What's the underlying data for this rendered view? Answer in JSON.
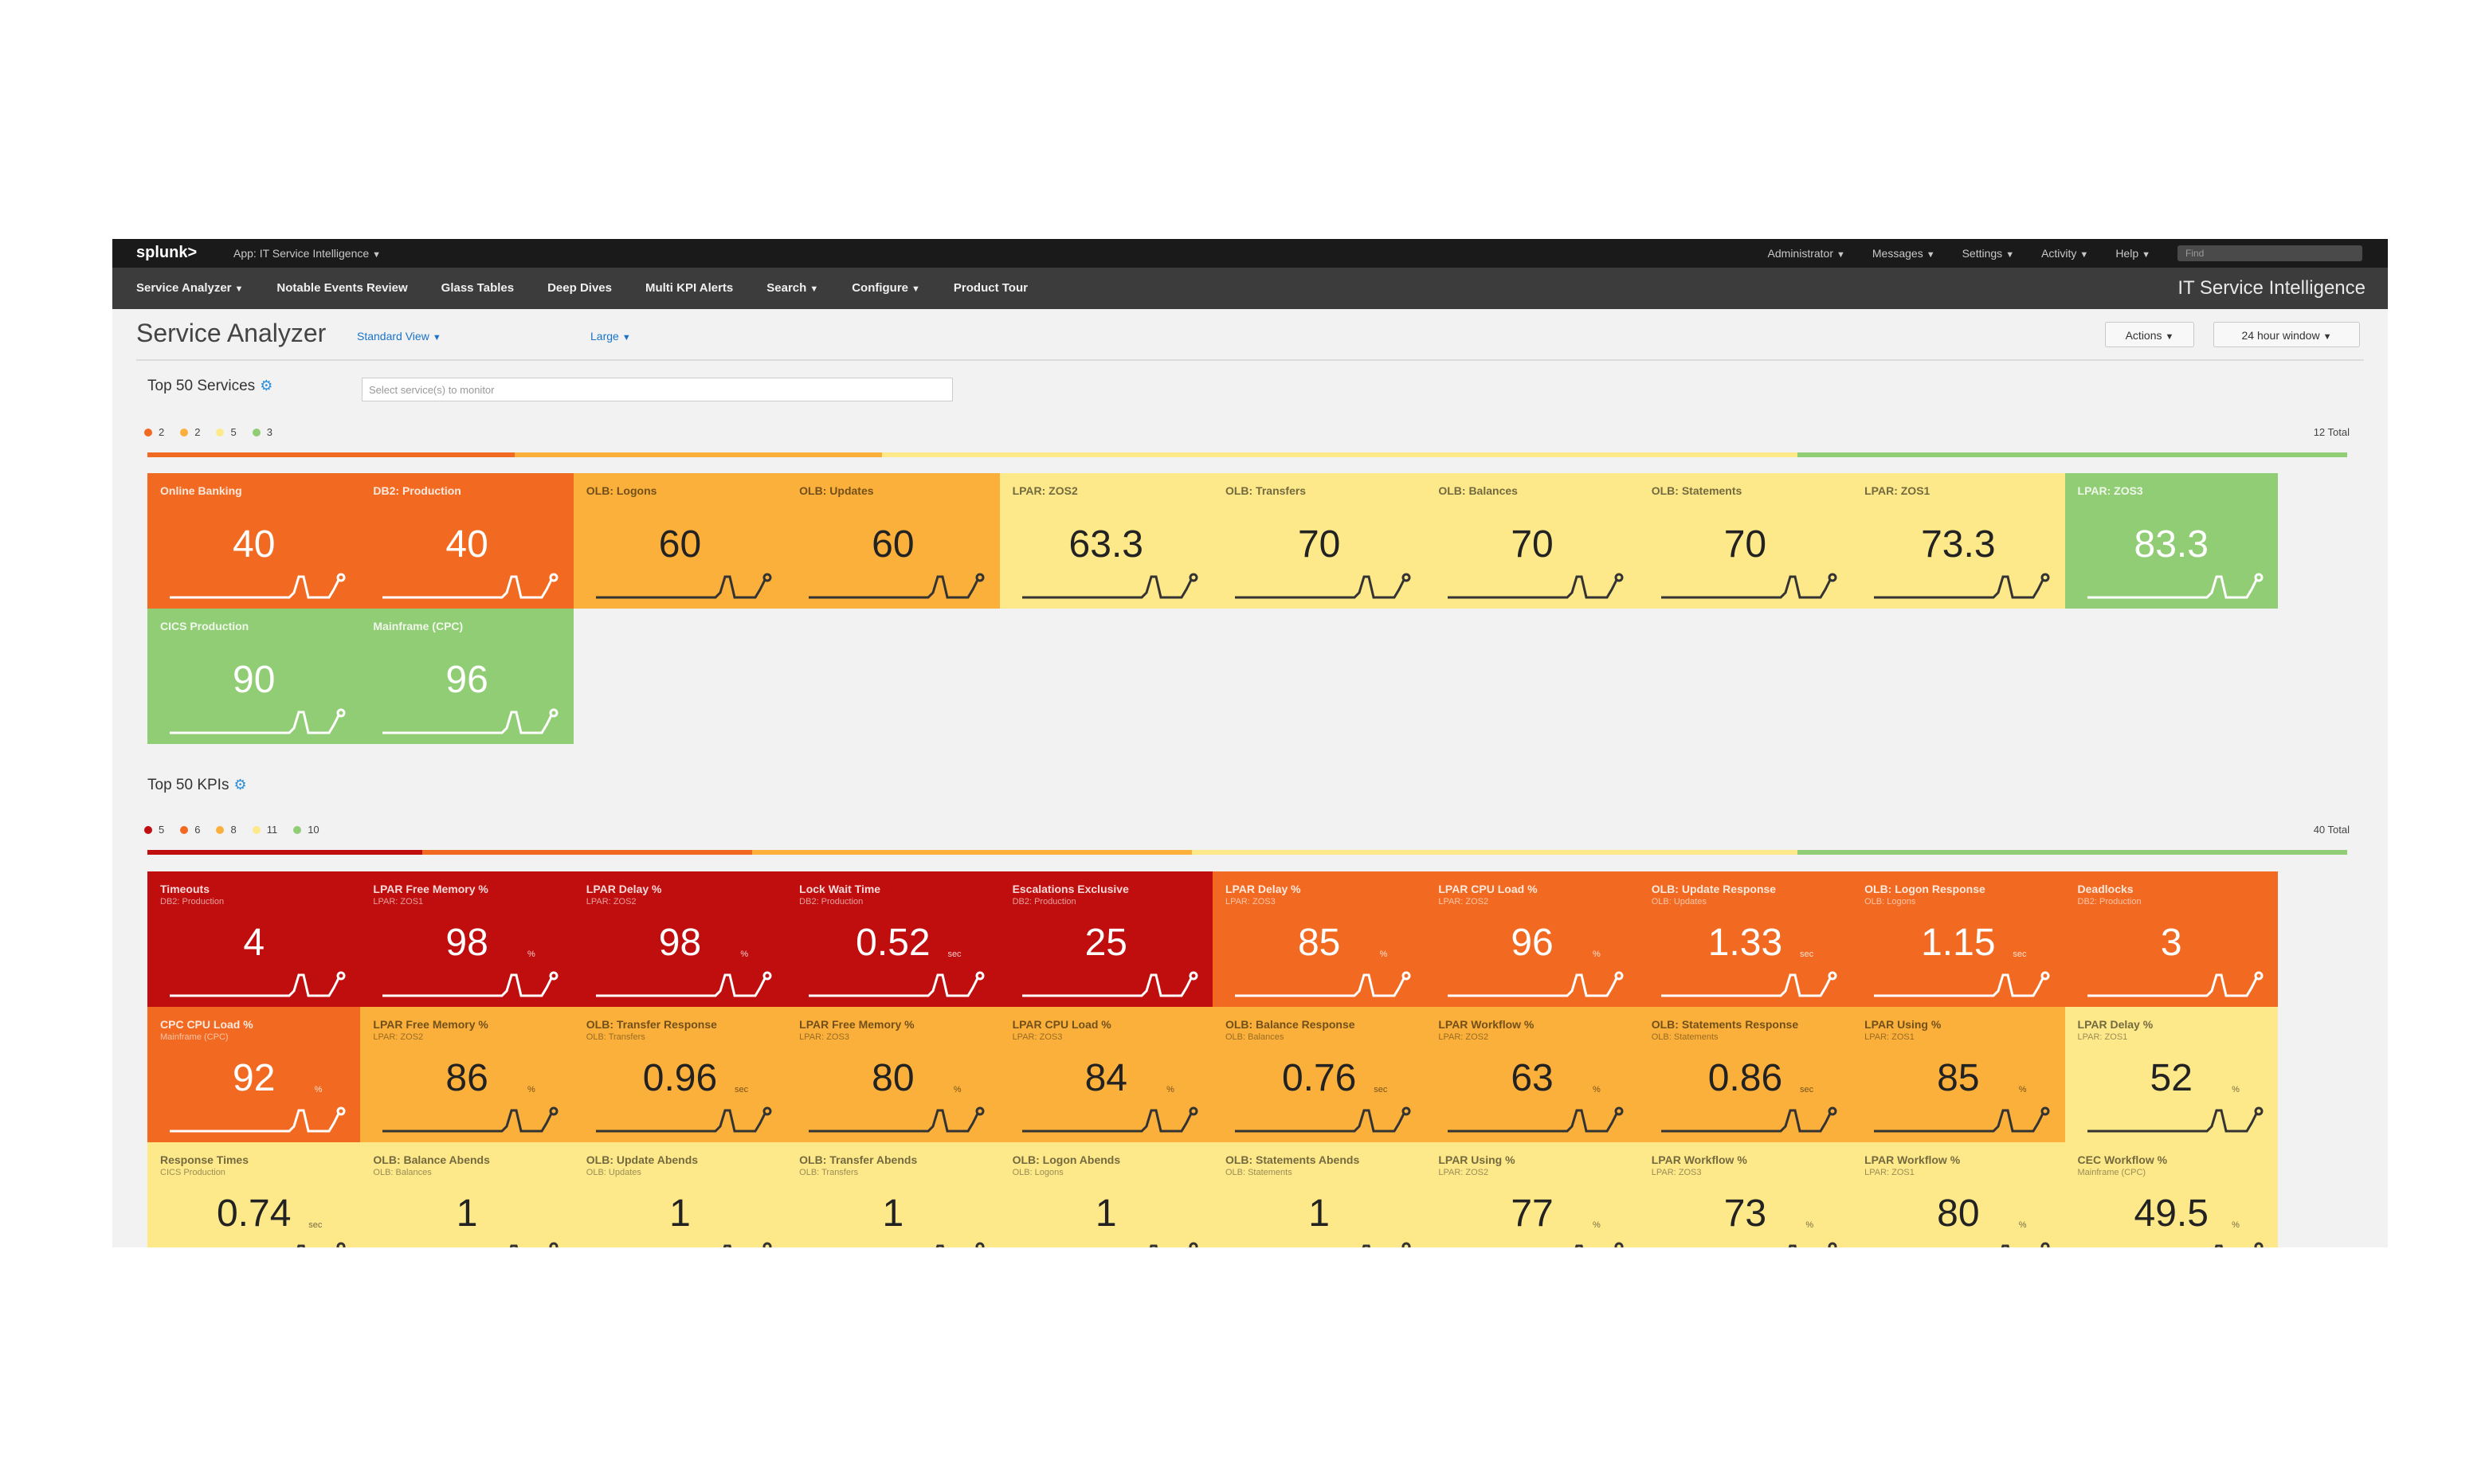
{
  "topbar": {
    "logo": "splunk>",
    "app": "App: IT Service Intelligence",
    "menus": [
      "Administrator",
      "Messages",
      "Settings",
      "Activity",
      "Help"
    ],
    "find_placeholder": "Find"
  },
  "nav": {
    "items": [
      {
        "label": "Service Analyzer",
        "caret": true
      },
      {
        "label": "Notable Events Review",
        "caret": false
      },
      {
        "label": "Glass Tables",
        "caret": false
      },
      {
        "label": "Deep Dives",
        "caret": false
      },
      {
        "label": "Multi KPI Alerts",
        "caret": false
      },
      {
        "label": "Search",
        "caret": true
      },
      {
        "label": "Configure",
        "caret": true
      },
      {
        "label": "Product Tour",
        "caret": false
      }
    ],
    "brand": "IT Service Intelligence"
  },
  "header": {
    "title": "Service Analyzer",
    "view": "Standard View",
    "size": "Large",
    "actions": "Actions",
    "window": "24 hour window"
  },
  "colors": {
    "critical": "#c00d0d",
    "high": "#f26a21",
    "medium": "#fbb03b",
    "low": "#fde88a",
    "normal": "#91cd75"
  },
  "services": {
    "title": "Top 50 Services",
    "selector_placeholder": "Select service(s) to monitor",
    "legend": [
      {
        "color": "#f26a21",
        "count": "2"
      },
      {
        "color": "#fbb03b",
        "count": "2"
      },
      {
        "color": "#fde88a",
        "count": "5"
      },
      {
        "color": "#91cd75",
        "count": "3"
      }
    ],
    "total": "12 Total",
    "bar": [
      {
        "color": "#f26a21",
        "fraction": 0.167
      },
      {
        "color": "#fbb03b",
        "fraction": 0.167
      },
      {
        "color": "#fde88a",
        "fraction": 0.416
      },
      {
        "color": "#91cd75",
        "fraction": 0.25
      }
    ],
    "tiles": [
      {
        "name": "Online Banking",
        "value": "40",
        "severity": "high"
      },
      {
        "name": "DB2: Production",
        "value": "40",
        "severity": "high"
      },
      {
        "name": "OLB: Logons",
        "value": "60",
        "severity": "medium"
      },
      {
        "name": "OLB: Updates",
        "value": "60",
        "severity": "medium"
      },
      {
        "name": "LPAR: ZOS2",
        "value": "63.3",
        "severity": "low"
      },
      {
        "name": "OLB: Transfers",
        "value": "70",
        "severity": "low"
      },
      {
        "name": "OLB: Balances",
        "value": "70",
        "severity": "low"
      },
      {
        "name": "OLB: Statements",
        "value": "70",
        "severity": "low"
      },
      {
        "name": "LPAR: ZOS1",
        "value": "73.3",
        "severity": "low"
      },
      {
        "name": "LPAR: ZOS3",
        "value": "83.3",
        "severity": "normal"
      },
      {
        "name": "CICS Production",
        "value": "90",
        "severity": "normal"
      },
      {
        "name": "Mainframe (CPC)",
        "value": "96",
        "severity": "normal"
      }
    ]
  },
  "kpis": {
    "title": "Top 50 KPIs",
    "legend": [
      {
        "color": "#c00d0d",
        "count": "5"
      },
      {
        "color": "#f26a21",
        "count": "6"
      },
      {
        "color": "#fbb03b",
        "count": "8"
      },
      {
        "color": "#fde88a",
        "count": "11"
      },
      {
        "color": "#91cd75",
        "count": "10"
      }
    ],
    "total": "40 Total",
    "bar": [
      {
        "color": "#c00d0d",
        "fraction": 0.125
      },
      {
        "color": "#f26a21",
        "fraction": 0.15
      },
      {
        "color": "#fbb03b",
        "fraction": 0.2
      },
      {
        "color": "#fde88a",
        "fraction": 0.275
      },
      {
        "color": "#91cd75",
        "fraction": 0.25
      }
    ],
    "tiles": [
      {
        "name": "Timeouts",
        "sub": "DB2: Production",
        "value": "4",
        "unit": "",
        "severity": "critical"
      },
      {
        "name": "LPAR Free Memory %",
        "sub": "LPAR: ZOS1",
        "value": "98",
        "unit": "%",
        "severity": "critical"
      },
      {
        "name": "LPAR Delay %",
        "sub": "LPAR: ZOS2",
        "value": "98",
        "unit": "%",
        "severity": "critical"
      },
      {
        "name": "Lock Wait Time",
        "sub": "DB2: Production",
        "value": "0.52",
        "unit": "sec",
        "severity": "critical"
      },
      {
        "name": "Escalations Exclusive",
        "sub": "DB2: Production",
        "value": "25",
        "unit": "",
        "severity": "critical"
      },
      {
        "name": "LPAR Delay %",
        "sub": "LPAR: ZOS3",
        "value": "85",
        "unit": "%",
        "severity": "high"
      },
      {
        "name": "LPAR CPU Load %",
        "sub": "LPAR: ZOS2",
        "value": "96",
        "unit": "%",
        "severity": "high"
      },
      {
        "name": "OLB: Update Response",
        "sub": "OLB: Updates",
        "value": "1.33",
        "unit": "sec",
        "severity": "high"
      },
      {
        "name": "OLB: Logon Response",
        "sub": "OLB: Logons",
        "value": "1.15",
        "unit": "sec",
        "severity": "high"
      },
      {
        "name": "Deadlocks",
        "sub": "DB2: Production",
        "value": "3",
        "unit": "",
        "severity": "high"
      },
      {
        "name": "CPC CPU Load %",
        "sub": "Mainframe (CPC)",
        "value": "92",
        "unit": "%",
        "severity": "high"
      },
      {
        "name": "LPAR Free Memory %",
        "sub": "LPAR: ZOS2",
        "value": "86",
        "unit": "%",
        "severity": "medium"
      },
      {
        "name": "OLB: Transfer Response",
        "sub": "OLB: Transfers",
        "value": "0.96",
        "unit": "sec",
        "severity": "medium"
      },
      {
        "name": "LPAR Free Memory %",
        "sub": "LPAR: ZOS3",
        "value": "80",
        "unit": "%",
        "severity": "medium"
      },
      {
        "name": "LPAR CPU Load %",
        "sub": "LPAR: ZOS3",
        "value": "84",
        "unit": "%",
        "severity": "medium"
      },
      {
        "name": "OLB: Balance Response",
        "sub": "OLB: Balances",
        "value": "0.76",
        "unit": "sec",
        "severity": "medium"
      },
      {
        "name": "LPAR Workflow %",
        "sub": "LPAR: ZOS2",
        "value": "63",
        "unit": "%",
        "severity": "medium"
      },
      {
        "name": "OLB: Statements Response",
        "sub": "OLB: Statements",
        "value": "0.86",
        "unit": "sec",
        "severity": "medium"
      },
      {
        "name": "LPAR Using %",
        "sub": "LPAR: ZOS1",
        "value": "85",
        "unit": "%",
        "severity": "medium"
      },
      {
        "name": "LPAR Delay %",
        "sub": "LPAR: ZOS1",
        "value": "52",
        "unit": "%",
        "severity": "low"
      },
      {
        "name": "Response Times",
        "sub": "CICS Production",
        "value": "0.74",
        "unit": "sec",
        "severity": "low"
      },
      {
        "name": "OLB: Balance Abends",
        "sub": "OLB: Balances",
        "value": "1",
        "unit": "",
        "severity": "low"
      },
      {
        "name": "OLB: Update Abends",
        "sub": "OLB: Updates",
        "value": "1",
        "unit": "",
        "severity": "low"
      },
      {
        "name": "OLB: Transfer Abends",
        "sub": "OLB: Transfers",
        "value": "1",
        "unit": "",
        "severity": "low"
      },
      {
        "name": "OLB: Logon Abends",
        "sub": "OLB: Logons",
        "value": "1",
        "unit": "",
        "severity": "low"
      },
      {
        "name": "OLB: Statements Abends",
        "sub": "OLB: Statements",
        "value": "1",
        "unit": "",
        "severity": "low"
      },
      {
        "name": "LPAR Using %",
        "sub": "LPAR: ZOS2",
        "value": "77",
        "unit": "%",
        "severity": "low"
      },
      {
        "name": "LPAR Workflow %",
        "sub": "LPAR: ZOS3",
        "value": "73",
        "unit": "%",
        "severity": "low"
      },
      {
        "name": "LPAR Workflow %",
        "sub": "LPAR: ZOS1",
        "value": "80",
        "unit": "%",
        "severity": "low"
      },
      {
        "name": "CEC Workflow %",
        "sub": "Mainframe (CPC)",
        "value": "49.5",
        "unit": "%",
        "severity": "low"
      }
    ]
  }
}
